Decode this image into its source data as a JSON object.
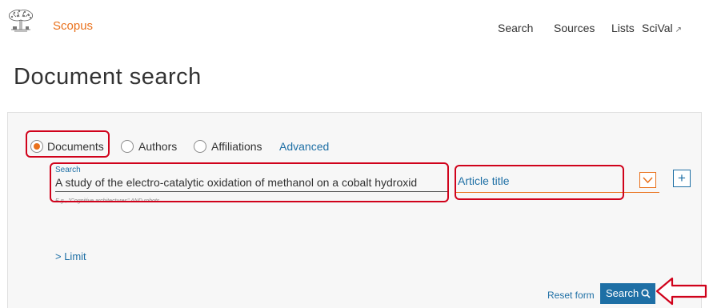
{
  "header": {
    "brand": "Scopus",
    "nav": {
      "search": "Search",
      "sources": "Sources",
      "lists": "Lists",
      "scival": "SciVal",
      "scival_ext": "↗"
    }
  },
  "page_title": "Document search",
  "search_type": {
    "options": [
      "Documents",
      "Authors",
      "Affiliations"
    ],
    "selected": "Documents",
    "advanced_link": "Advanced"
  },
  "search_field": {
    "label": "Search",
    "value": "A study of the electro-catalytic oxidation of methanol on a cobalt hydroxid",
    "hint": "E.g., \"Cognitive architectures\" AND robots"
  },
  "field_select": {
    "selected": "Article title"
  },
  "add_field_label": "+",
  "limit_label": "> Limit",
  "actions": {
    "reset": "Reset form",
    "search": "Search"
  },
  "colors": {
    "brand_orange": "#e9711c",
    "link_blue": "#1e6fa5",
    "annotation_red": "#d0021b"
  }
}
